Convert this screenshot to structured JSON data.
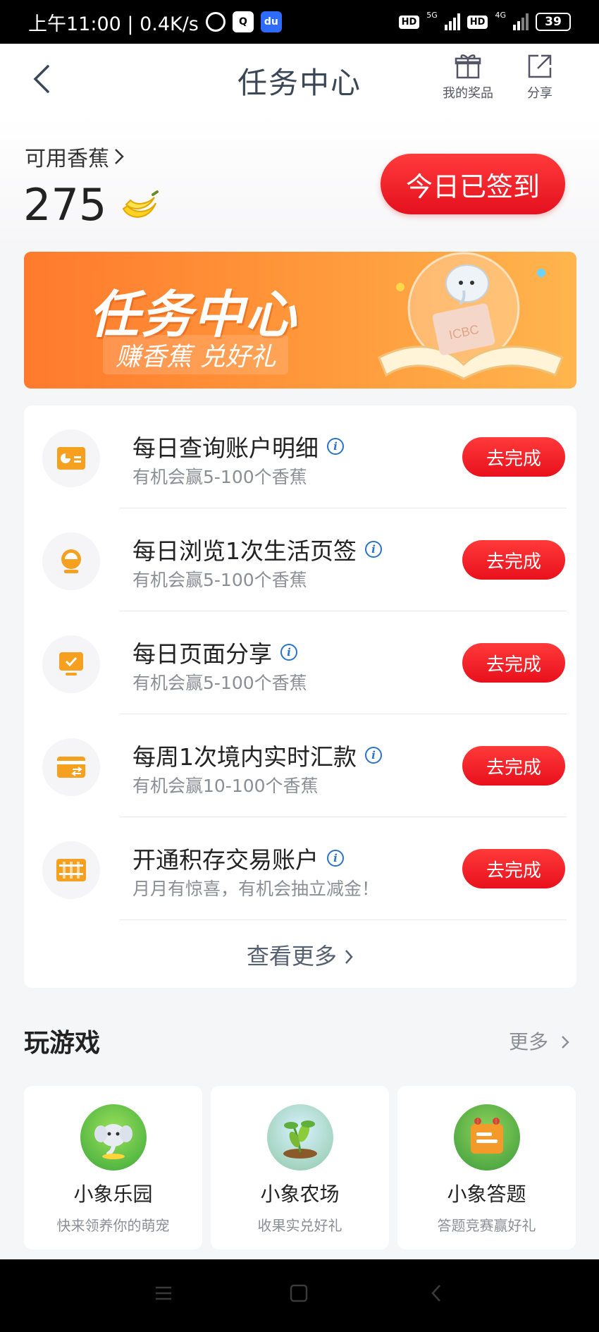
{
  "status_bar": {
    "time_speed": "上午11:00 | 0.4K/s",
    "hd1": "HD",
    "net1": "5G",
    "hd2": "HD",
    "net2": "4G",
    "battery": "39"
  },
  "header": {
    "title": "任务中心",
    "prize_label": "我的奖品",
    "share_label": "分享"
  },
  "balance": {
    "label": "可用香蕉",
    "value": "275",
    "sign_button": "今日已签到"
  },
  "banner": {
    "title": "任务中心",
    "subtitle": "赚香蕉 兑好礼",
    "logo_text": "ICBC"
  },
  "tasks": [
    {
      "title": "每日查询账户明细",
      "desc": "有机会赢5-100个香蕉",
      "button": "去完成",
      "icon": "account-detail-icon"
    },
    {
      "title": "每日浏览1次生活页签",
      "desc": "有机会赢5-100个香蕉",
      "button": "去完成",
      "icon": "life-tab-icon"
    },
    {
      "title": "每日页面分享",
      "desc": "有机会赢5-100个香蕉",
      "button": "去完成",
      "icon": "page-share-icon"
    },
    {
      "title": "每周1次境内实时汇款",
      "desc": "有机会赢10-100个香蕉",
      "button": "去完成",
      "icon": "remittance-card-icon"
    },
    {
      "title": "开通积存交易账户",
      "desc": "月月有惊喜，有机会抽立减金！",
      "button": "去完成",
      "icon": "savings-account-icon"
    }
  ],
  "view_more": "查看更多",
  "games": {
    "title": "玩游戏",
    "more": "更多",
    "items": [
      {
        "name": "小象乐园",
        "desc": "快来领养你的萌宠"
      },
      {
        "name": "小象农场",
        "desc": "收果实兑好礼"
      },
      {
        "name": "小象答题",
        "desc": "答题竞赛赢好礼"
      }
    ]
  },
  "colors": {
    "accent_red": "#e8101c",
    "task_orange": "#f6a020",
    "info_blue": "#2a73c8"
  }
}
